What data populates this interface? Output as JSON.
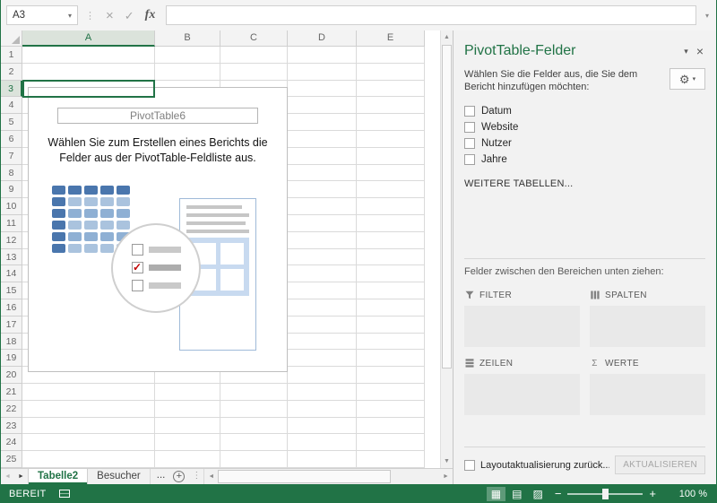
{
  "app": {
    "accent_color": "#217346"
  },
  "icons": {
    "name_box_caret": "▾",
    "cancel": "×",
    "enter": "✓",
    "function": "fx",
    "handle_dots": "⋮",
    "pane_options_caret": "▾",
    "pane_close": "×",
    "gear": "⚙",
    "gear_caret": "▾",
    "sigma": "Σ",
    "tab_nav_left": "◄",
    "tab_nav_right": "►",
    "scroll_up": "▲",
    "scroll_down": "▼",
    "scroll_left": "◄",
    "add_sheet": "+",
    "view_normal": "▦",
    "view_layout": "▤",
    "view_break": "▨",
    "zoom_out": "−",
    "zoom_in": "+"
  },
  "formula_bar": {
    "name_box": "A3",
    "formula_value": ""
  },
  "grid": {
    "columns": [
      "A",
      "B",
      "C",
      "D",
      "E"
    ],
    "rows": [
      "1",
      "2",
      "3",
      "4",
      "5",
      "6",
      "7",
      "8",
      "9",
      "10",
      "11",
      "12",
      "13",
      "14",
      "15",
      "16",
      "17",
      "18",
      "19",
      "20",
      "21",
      "22",
      "23",
      "24",
      "25"
    ],
    "selected_column": "A",
    "selected_row": "3",
    "selected_cell": "A3"
  },
  "placeholder": {
    "title": "PivotTable6",
    "instruction": "Wählen Sie zum Erstellen eines Berichts die Felder aus der PivotTable-Feldliste aus."
  },
  "panel": {
    "title": "PivotTable-Felder",
    "instruction": "Wählen Sie die Felder aus, die Sie dem Bericht hinzufügen möchten:",
    "fields": [
      {
        "label": "Datum",
        "checked": false
      },
      {
        "label": "Website",
        "checked": false
      },
      {
        "label": "Nutzer",
        "checked": false
      },
      {
        "label": "Jahre",
        "checked": false
      }
    ],
    "more_tables": "WEITERE TABELLEN...",
    "drag_hint": "Felder zwischen den Bereichen unten ziehen:",
    "areas": [
      {
        "label": "FILTER",
        "icon": "filter-icon"
      },
      {
        "label": "SPALTEN",
        "icon": "columns-icon"
      },
      {
        "label": "ZEILEN",
        "icon": "rows-icon"
      },
      {
        "label": "WERTE",
        "icon": "sigma-icon"
      }
    ],
    "defer_label": "Layoutaktualisierung zurück...",
    "update_button": "AKTUALISIEREN"
  },
  "sheet_bar": {
    "tabs": [
      {
        "label": "Tabelle2",
        "active": true
      },
      {
        "label": "Besucher",
        "active": false
      }
    ],
    "overflow": "..."
  },
  "status_bar": {
    "ready": "BEREIT",
    "zoom_level": "100 %"
  }
}
